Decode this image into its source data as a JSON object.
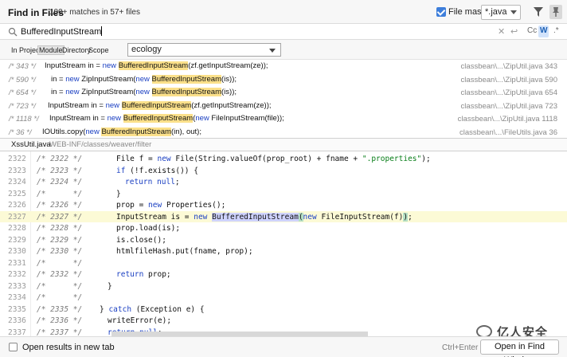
{
  "header": {
    "title": "Find in Files",
    "match_count": "100+ matches in 57+ files",
    "file_mask_label": "File mask:",
    "file_mask_value": "*.java",
    "file_mask_checked": true
  },
  "search": {
    "query": "BufferedInputStream",
    "toggles": {
      "case": "Cc",
      "words": "W",
      "regex": ".*"
    }
  },
  "scope": {
    "tabs": [
      "In Project",
      "Module",
      "Directory",
      "Scope"
    ],
    "active_tab": "Module",
    "selected_module": "ecology"
  },
  "results": [
    {
      "line": "/* 343 */",
      "pre": "InputStream in = ",
      "kw": "new",
      "match": "BufferedInputStream",
      "post": "(zf.getInputStream(ze));",
      "location": "classbean\\...\\ZipUtil.java 343"
    },
    {
      "line": "/* 590 */",
      "pre": "in = ",
      "kw": "new",
      "mid": " ZipInputStream(",
      "kw2": "new",
      "match": "BufferedInputStream",
      "post": "(is));",
      "location": "classbean\\...\\ZipUtil.java 590"
    },
    {
      "line": "/* 654 */",
      "pre": "in = ",
      "kw": "new",
      "mid": " ZipInputStream(",
      "kw2": "new",
      "match": "BufferedInputStream",
      "post": "(is));",
      "location": "classbean\\...\\ZipUtil.java 654"
    },
    {
      "line": "/* 723 */",
      "pre": "InputStream in = ",
      "kw": "new",
      "match": "BufferedInputStream",
      "post": "(zf.getInputStream(ze));",
      "location": "classbean\\...\\ZipUtil.java 723"
    },
    {
      "line": "/* 1118 */",
      "pre": "InputStream in = ",
      "kw": "new",
      "match": "BufferedInputStream",
      "post2_kw": "new",
      "post": " FileInputStream(file));",
      "location": "classbean\\...\\ZipUtil.java 1118"
    },
    {
      "line": "/* 36 */",
      "pre": "IOUtils.copy(",
      "kw": "new",
      "match": "BufferedInputStream",
      "post": "(in), out);",
      "location": "classbean\\...\\FileUtils.java 36"
    }
  ],
  "preview": {
    "file_name": "XssUtil.java",
    "file_path": "WEB-INF/classes/weaver/filter"
  },
  "editor_lines": [
    {
      "num": "2322",
      "comment": "/* 2322 */",
      "code": "File f = new File(String.valueOf(prop_root) + fname + \".properties\");"
    },
    {
      "num": "2323",
      "comment": "/* 2323 */",
      "code": "if (!f.exists()) {"
    },
    {
      "num": "2324",
      "comment": "/* 2324 */",
      "code": "return null;"
    },
    {
      "num": "2325",
      "comment": "/*      */",
      "code": "}"
    },
    {
      "num": "2326",
      "comment": "/* 2326 */",
      "code": "prop = new Properties();"
    },
    {
      "num": "2327",
      "comment": "/* 2327 */",
      "code": "InputStream is = new BufferedInputStream(new FileInputStream(f));"
    },
    {
      "num": "2328",
      "comment": "/* 2328 */",
      "code": "prop.load(is);"
    },
    {
      "num": "2329",
      "comment": "/* 2329 */",
      "code": "is.close();"
    },
    {
      "num": "2330",
      "comment": "/* 2330 */",
      "code": "htmlfileHash.put(fname, prop);"
    },
    {
      "num": "2331",
      "comment": "/*      */",
      "code": ""
    },
    {
      "num": "2332",
      "comment": "/* 2332 */",
      "code": "return prop;"
    },
    {
      "num": "2333",
      "comment": "/*      */",
      "code": "}"
    },
    {
      "num": "2334",
      "comment": "/*      */",
      "code": ""
    },
    {
      "num": "2335",
      "comment": "/* 2335 */",
      "code": "} catch (Exception e) {"
    },
    {
      "num": "2336",
      "comment": "/* 2336 */",
      "code": "writeError(e);"
    },
    {
      "num": "2337",
      "comment": "/* 2337 */",
      "code": "return null;"
    }
  ],
  "footer": {
    "open_in_new_tab_label": "Open results in new tab",
    "shortcut": "Ctrl+Enter",
    "open_button": "Open in Find Window"
  },
  "watermark": {
    "text": "亿人安全"
  },
  "colors": {
    "accent": "#3d7edb",
    "match_highlight": "#fbe08a",
    "keyword": "#1a3fc2",
    "string": "#067d17",
    "current_line": "#fcfad6"
  }
}
